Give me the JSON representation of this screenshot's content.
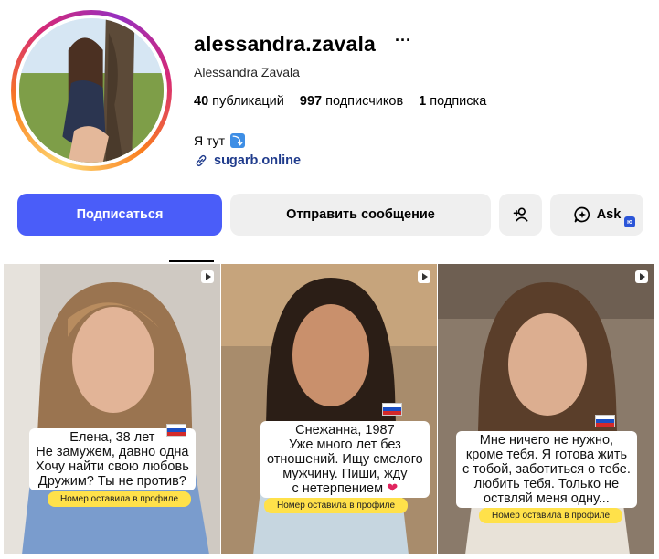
{
  "profile": {
    "username": "alessandra.zavala",
    "full_name": "Alessandra Zavala",
    "more_symbol": "···",
    "stats": {
      "posts_count": "40",
      "posts_label": "публикаций",
      "followers_count": "997",
      "followers_label": "подписчиков",
      "following_count": "1",
      "following_label": "подписка"
    },
    "bio_text": "Я тут",
    "bio_emoji": "⤵",
    "link": "sugarb.online"
  },
  "actions": {
    "follow": "Подписаться",
    "message": "Отправить сообщение",
    "ask": "Ask",
    "ai_badge": "ю"
  },
  "colors": {
    "follow_button": "#4a5df9",
    "secondary_button": "#efefef",
    "link": "#1f3b8c",
    "tag_yellow": "#ffe14a"
  },
  "posts": [
    {
      "caption_lines": [
        "Елена, 38 лет",
        "Не замужем, давно одна",
        "Хочу найти свою любовь",
        "Дружим? Ты не против?"
      ],
      "tag": "Номер оставила в профиле",
      "type_icon": "reel-icon"
    },
    {
      "caption_lines": [
        "Снежанна, 1987",
        "Уже много лет без",
        "отношений. Ищу смелого",
        "мужчину. Пиши, жду",
        "с нетерпением"
      ],
      "heart": "❤",
      "tag": "Номер оставила в профиле",
      "type_icon": "reel-icon"
    },
    {
      "caption_lines": [
        "Мне ничего не нужно,",
        "кроме тебя. Я готова жить",
        "с тобой, заботиться о тебе.",
        "любить тебя. Только не",
        "оствляй меня одну..."
      ],
      "tag": "Номер оставила в профиле",
      "type_icon": "reel-icon"
    }
  ]
}
